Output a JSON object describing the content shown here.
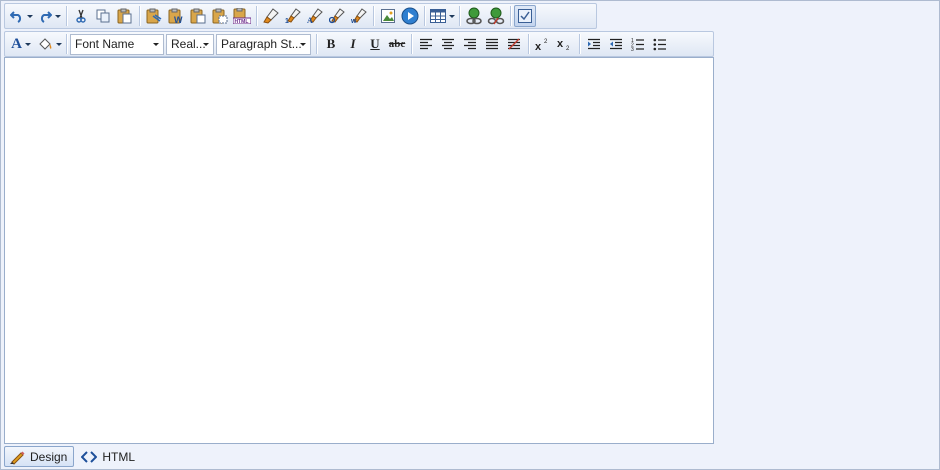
{
  "toolbar1": {
    "buttons": [
      {
        "name": "undo",
        "icon": "undo-icon"
      },
      {
        "name": "redo",
        "icon": "redo-icon"
      },
      {
        "name": "cut",
        "icon": "scissors-icon"
      },
      {
        "name": "copy",
        "icon": "copy-icon"
      },
      {
        "name": "paste",
        "icon": "paste-icon"
      },
      {
        "name": "paste-text",
        "icon": "paste-text-icon"
      },
      {
        "name": "paste-word",
        "icon": "paste-word-icon"
      },
      {
        "name": "paste-plain",
        "icon": "paste-plain-icon"
      },
      {
        "name": "paste-format",
        "icon": "paste-format-icon"
      },
      {
        "name": "paste-html",
        "icon": "paste-html-icon"
      },
      {
        "name": "format-clear",
        "icon": "brush-icon"
      },
      {
        "name": "format-1",
        "icon": "brush-1-icon"
      },
      {
        "name": "format-a",
        "icon": "brush-a-icon"
      },
      {
        "name": "format-2",
        "icon": "brush-2-icon"
      },
      {
        "name": "format-3",
        "icon": "brush-3-icon"
      },
      {
        "name": "insert-image",
        "icon": "image-icon"
      },
      {
        "name": "insert-media",
        "icon": "media-play-icon"
      },
      {
        "name": "insert-table",
        "icon": "table-icon"
      },
      {
        "name": "insert-link",
        "icon": "link-icon"
      },
      {
        "name": "remove-link",
        "icon": "unlink-icon"
      },
      {
        "name": "fullscreen",
        "icon": "fullscreen-icon"
      }
    ]
  },
  "toolbar2": {
    "font_name": "Font Name",
    "font_size": "Real...",
    "paragraph_style": "Paragraph St...",
    "bold_label": "B",
    "italic_label": "I",
    "underline_label": "U",
    "strike_label": "abc"
  },
  "modes": {
    "design_label": "Design",
    "html_label": "HTML"
  },
  "colors": {
    "toolbar_bg": "#dfe7f4",
    "border": "#b9c8e0",
    "icon_blue": "#2f6ab3",
    "accent_orange": "#e08a1e"
  }
}
